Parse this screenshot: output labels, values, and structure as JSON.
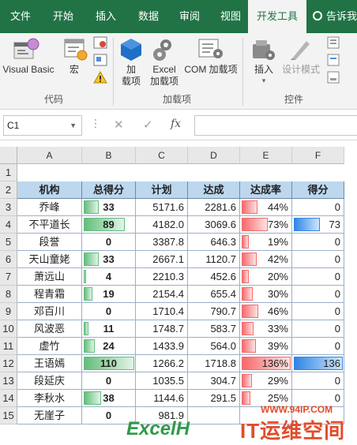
{
  "ribbon_tabs": [
    "文件",
    "开始",
    "插入",
    "数据",
    "审阅",
    "视图",
    "开发工具"
  ],
  "active_tab": "开发工具",
  "tell_me": "告诉我",
  "ribbon": {
    "visual_basic": "Visual Basic",
    "macro": "宏",
    "addins_line1": "加",
    "addins_line2": "载项",
    "excel_addins_line1": "Excel",
    "excel_addins_line2": "加载项",
    "com_addins": "COM 加载项",
    "insert": "插入",
    "design_mode": "设计模式",
    "group_code": "代码",
    "group_addins": "加载项",
    "group_controls": "控件"
  },
  "formula_bar": {
    "name_box": "C1",
    "formula": ""
  },
  "columns": [
    "A",
    "B",
    "C",
    "D",
    "E",
    "F"
  ],
  "rows": [
    "1",
    "2",
    "3",
    "4",
    "5",
    "6",
    "7",
    "8",
    "9",
    "10",
    "11",
    "12",
    "13",
    "14",
    "15"
  ],
  "table": {
    "headers": [
      "机构",
      "总得分",
      "计划",
      "达成",
      "达成率",
      "得分"
    ],
    "records": [
      {
        "name": "乔峰",
        "score": "33",
        "plan": "5171.6",
        "actual": "2281.6",
        "rate": "44%",
        "points": "0"
      },
      {
        "name": "不平道长",
        "score": "89",
        "plan": "4182.0",
        "actual": "3069.6",
        "rate": "73%",
        "points": "73"
      },
      {
        "name": "段誉",
        "score": "0",
        "plan": "3387.8",
        "actual": "646.3",
        "rate": "19%",
        "points": "0"
      },
      {
        "name": "天山童姥",
        "score": "33",
        "plan": "2667.1",
        "actual": "1120.7",
        "rate": "42%",
        "points": "0"
      },
      {
        "name": "萧远山",
        "score": "4",
        "plan": "2210.3",
        "actual": "452.6",
        "rate": "20%",
        "points": "0"
      },
      {
        "name": "程青霜",
        "score": "19",
        "plan": "2154.4",
        "actual": "655.4",
        "rate": "30%",
        "points": "0"
      },
      {
        "name": "邓百川",
        "score": "0",
        "plan": "1710.4",
        "actual": "790.7",
        "rate": "46%",
        "points": "0"
      },
      {
        "name": "风波恶",
        "score": "11",
        "plan": "1748.7",
        "actual": "583.7",
        "rate": "33%",
        "points": "0"
      },
      {
        "name": "虚竹",
        "score": "24",
        "plan": "1433.9",
        "actual": "564.0",
        "rate": "39%",
        "points": "0"
      },
      {
        "name": "王语嫣",
        "score": "110",
        "plan": "1266.2",
        "actual": "1718.8",
        "rate": "136%",
        "points": "136"
      },
      {
        "name": "段延庆",
        "score": "0",
        "plan": "1035.5",
        "actual": "304.7",
        "rate": "29%",
        "points": "0"
      },
      {
        "name": "李秋水",
        "score": "38",
        "plan": "1144.6",
        "actual": "291.5",
        "rate": "25%",
        "points": "0"
      },
      {
        "name": "无崖子",
        "score": "0",
        "plan": "981.9",
        "actual": "",
        "rate": "",
        "points": ""
      }
    ]
  },
  "watermark": {
    "site": "WWW.94IP.COM",
    "brand": "IT运维空间",
    "excel": "ExcelH"
  }
}
